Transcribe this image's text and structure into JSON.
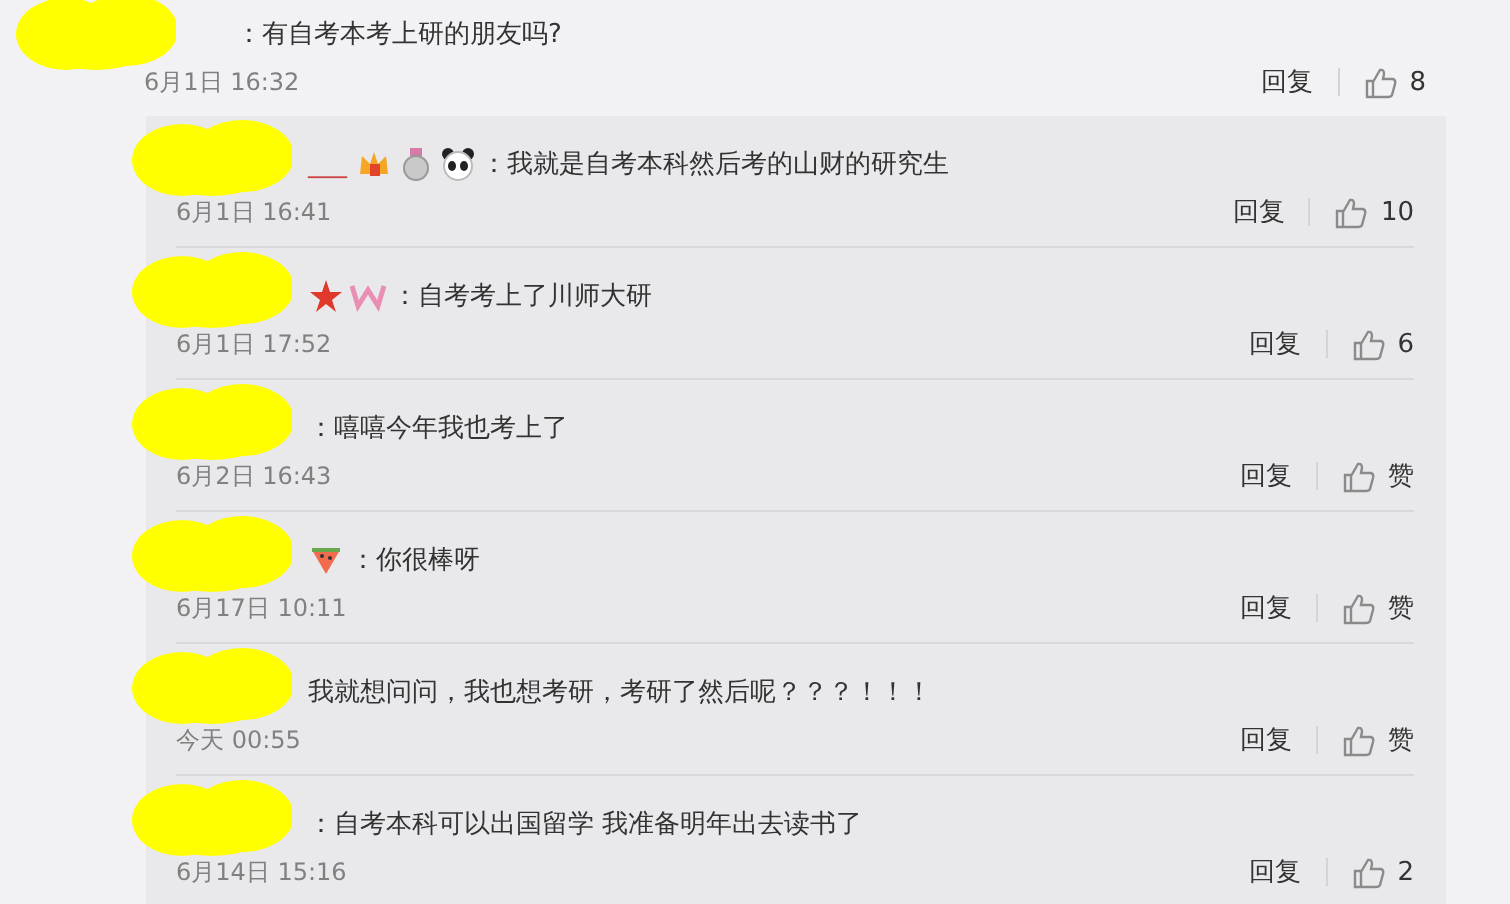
{
  "comment": {
    "redacted": true,
    "text": "：有自考本考上研的朋友吗?",
    "time": "6月1日 16:32",
    "reply": "回复",
    "likes": "8"
  },
  "replies": [
    {
      "redacted": true,
      "name": "___",
      "badges": [
        {
          "kind": "crown"
        },
        {
          "kind": "medal"
        },
        {
          "kind": "panda"
        }
      ],
      "text": "：我就是自考本科然后考的山财的研究生",
      "time": "6月1日 16:41",
      "reply": "回复",
      "likes": "10"
    },
    {
      "redacted": true,
      "badges": [
        {
          "kind": "star"
        },
        {
          "kind": "w"
        }
      ],
      "text": "：自考考上了川师大研",
      "time": "6月1日 17:52",
      "reply": "回复",
      "likes": "6"
    },
    {
      "redacted": true,
      "text": "：嘻嘻今年我也考上了",
      "time": "6月2日 16:43",
      "reply": "回复",
      "likes": "赞"
    },
    {
      "redacted": true,
      "badges": [
        {
          "kind": "watermelon"
        }
      ],
      "text": "：你很棒呀",
      "time": "6月17日 10:11",
      "reply": "回复",
      "likes": "赞"
    },
    {
      "redacted": true,
      "text": "我就想问问，我也想考研，考研了然后呢？？？！！！",
      "time": "今天 00:55",
      "reply": "回复",
      "likes": "赞"
    },
    {
      "redacted": true,
      "text": "：自考本科可以出国留学 我准备明年出去读书了",
      "time": "6月14日 15:16",
      "reply": "回复",
      "likes": "2"
    }
  ]
}
